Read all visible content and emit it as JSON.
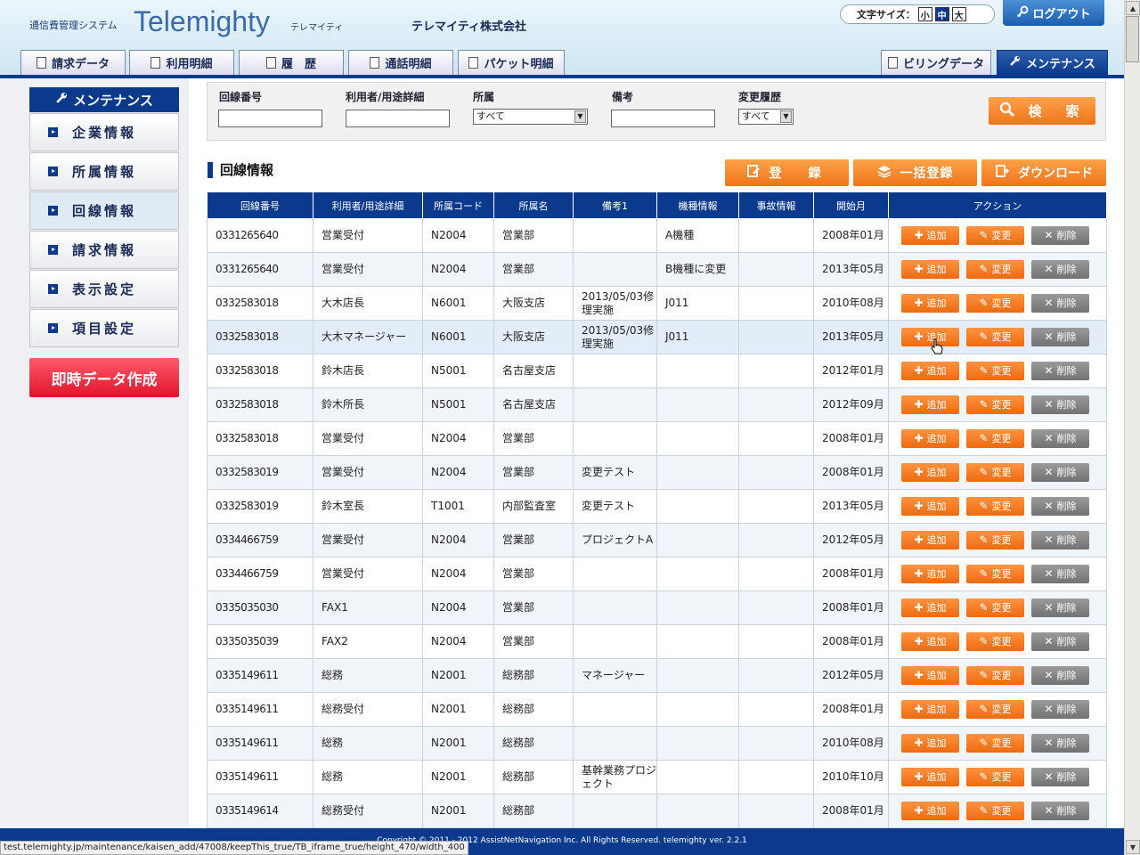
{
  "header": {
    "system_name": "通信費管理システム",
    "logo": "Telemighty",
    "logo_kana": "テレマイティ",
    "company": "テレマイティ株式会社",
    "font_size_label": "文字サイズ：",
    "font_sizes": [
      "小",
      "中",
      "大"
    ],
    "font_size_selected": "中",
    "logout": "ログアウト",
    "tabs": [
      "請求データ",
      "利用明細",
      "履　歴",
      "通話明細",
      "パケット明細"
    ],
    "right_tabs": [
      "ビリングデータ",
      "メンテナンス"
    ],
    "active_tab": "メンテナンス"
  },
  "sidebar": {
    "title": "メンテナンス",
    "items": [
      "企業情報",
      "所属情報",
      "回線情報",
      "請求情報",
      "表示設定",
      "項目設定"
    ],
    "active_item": "回線情報",
    "instant_button": "即時データ作成"
  },
  "search": {
    "line_label": "回線番号",
    "line_value": "",
    "user_label": "利用者/用途詳細",
    "user_value": "",
    "dept_label": "所属",
    "dept_value": "すべて",
    "note_label": "備考",
    "note_value": "",
    "history_label": "変更履歴",
    "history_value": "すべて",
    "button": "検　索"
  },
  "section": {
    "title": "回線情報",
    "register": "登　録",
    "bulk_register": "一括登録",
    "download": "ダウンロード"
  },
  "table": {
    "headers": [
      "回線番号",
      "利用者/用途詳細",
      "所属コード",
      "所属名",
      "備考1",
      "機種情報",
      "事故情報",
      "開始月",
      "アクション"
    ],
    "action_labels": {
      "add": "追加",
      "edit": "変更",
      "delete": "削除"
    },
    "rows": [
      [
        "0331265640",
        "営業受付",
        "N2004",
        "営業部",
        "",
        "A機種",
        "",
        "2008年01月"
      ],
      [
        "0331265640",
        "営業受付",
        "N2004",
        "営業部",
        "",
        "B機種に変更",
        "",
        "2013年05月"
      ],
      [
        "0332583018",
        "大木店長",
        "N6001",
        "大阪支店",
        "2013/05/03修理実施",
        "J011",
        "",
        "2010年08月"
      ],
      [
        "0332583018",
        "大木マネージャー",
        "N6001",
        "大阪支店",
        "2013/05/03修理実施",
        "J011",
        "",
        "2013年05月"
      ],
      [
        "0332583018",
        "鈴木店長",
        "N5001",
        "名古屋支店",
        "",
        "",
        "",
        "2012年01月"
      ],
      [
        "0332583018",
        "鈴木所長",
        "N5001",
        "名古屋支店",
        "",
        "",
        "",
        "2012年09月"
      ],
      [
        "0332583018",
        "営業受付",
        "N2004",
        "営業部",
        "",
        "",
        "",
        "2008年01月"
      ],
      [
        "0332583019",
        "営業受付",
        "N2004",
        "営業部",
        "変更テスト",
        "",
        "",
        "2008年01月"
      ],
      [
        "0332583019",
        "鈴木室長",
        "T1001",
        "内部監査室",
        "変更テスト",
        "",
        "",
        "2013年05月"
      ],
      [
        "0334466759",
        "営業受付",
        "N2004",
        "営業部",
        "プロジェクトA",
        "",
        "",
        "2012年05月"
      ],
      [
        "0334466759",
        "営業受付",
        "N2004",
        "営業部",
        "",
        "",
        "",
        "2008年01月"
      ],
      [
        "0335035030",
        "FAX1",
        "N2004",
        "営業部",
        "",
        "",
        "",
        "2008年01月"
      ],
      [
        "0335035039",
        "FAX2",
        "N2004",
        "営業部",
        "",
        "",
        "",
        "2008年01月"
      ],
      [
        "0335149611",
        "総務",
        "N2001",
        "総務部",
        "マネージャー",
        "",
        "",
        "2012年05月"
      ],
      [
        "0335149611",
        "総務受付",
        "N2001",
        "総務部",
        "",
        "",
        "",
        "2008年01月"
      ],
      [
        "0335149611",
        "総務",
        "N2001",
        "総務部",
        "",
        "",
        "",
        "2010年08月"
      ],
      [
        "0335149611",
        "総務",
        "N2001",
        "総務部",
        "基幹業務プロジェクト",
        "",
        "",
        "2010年10月"
      ],
      [
        "0335149614",
        "総務受付",
        "N2001",
        "総務部",
        "",
        "",
        "",
        "2008年01月"
      ]
    ]
  },
  "footer": "Copyright © 2011 - 2012 AssistNetNavigation Inc. All Rights Reserved. telemighty ver. 2.2.1",
  "status_url": "test.telemighty.jp/maintenance/kaisen_add/47008/keepThis_true/TB_iframe_true/height_470/width_400"
}
